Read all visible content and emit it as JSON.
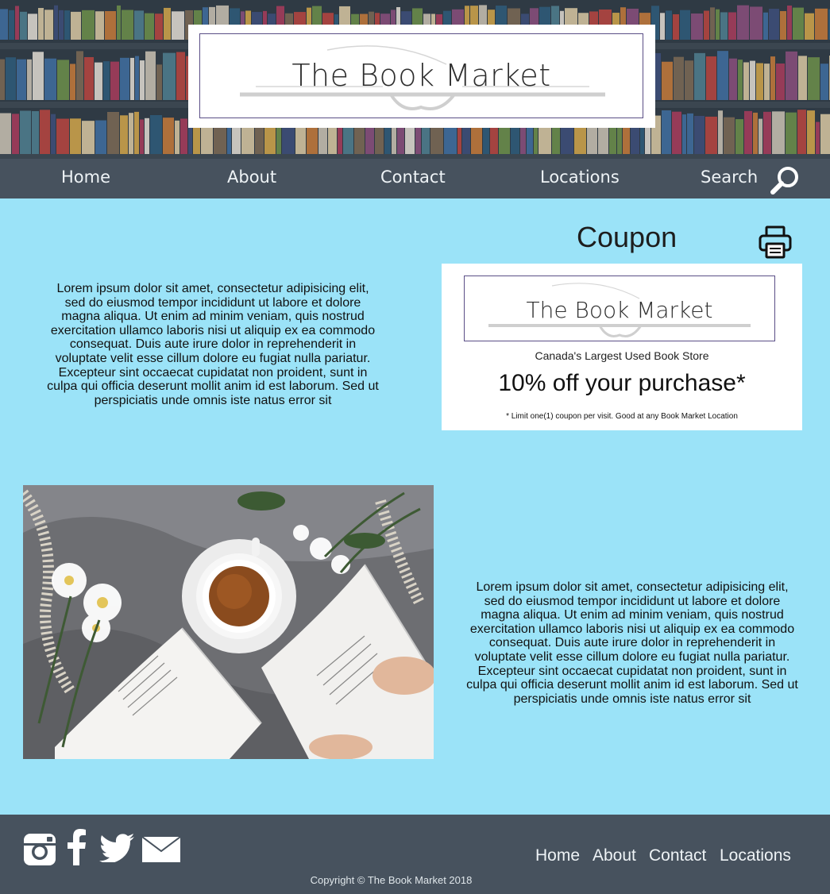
{
  "brand": {
    "name": "The Book Market"
  },
  "nav": {
    "items": [
      "Home",
      "About",
      "Contact",
      "Locations",
      "Search"
    ],
    "search_icon": "search-icon"
  },
  "coupon": {
    "title": "Coupon",
    "print_icon": "printer-icon",
    "logo_text": "The Book Market",
    "tagline": "Canada's Largest Used Book Store",
    "offer": "10% off your purchase*",
    "fine_print": "* Limit one(1) coupon per visit. Good at any Book Market Location"
  },
  "content": {
    "paragraph_1": "Lorem ipsum dolor sit amet, consectetur adipisicing elit, sed do eiusmod tempor incididunt ut labore et dolore magna aliqua. Ut enim ad minim veniam, quis nostrud exercitation ullamco laboris nisi ut aliquip ex ea commodo consequat. Duis aute irure dolor in reprehenderit in voluptate velit esse cillum dolore eu fugiat nulla pariatur. Excepteur sint occaecat cupidatat non proident, sunt in culpa qui officia deserunt mollit anim id est laborum. Sed ut perspiciatis unde omnis iste natus error sit",
    "paragraph_2": "Lorem ipsum dolor sit amet, consectetur adipisicing elit, sed do eiusmod tempor incididunt ut labore et dolore magna aliqua. Ut enim ad minim veniam, quis nostrud exercitation ullamco laboris nisi ut aliquip ex ea commodo consequat. Duis aute irure dolor in reprehenderit in voluptate velit esse cillum dolore eu fugiat nulla pariatur. Excepteur sint occaecat cupidatat non proident, sunt in culpa qui officia deserunt mollit anim id est laborum. Sed ut perspiciatis unde omnis iste natus error sit"
  },
  "footer": {
    "social_icons": [
      "instagram-icon",
      "facebook-icon",
      "twitter-icon",
      "email-icon"
    ],
    "links": [
      "Home",
      "About",
      "Contact",
      "Locations"
    ],
    "copyright": "Copyright © The Book Market 2018"
  },
  "colors": {
    "page_background": "#9be3f8",
    "nav_background": "#47525e",
    "footer_background": "#47525e",
    "logo_border": "#5a4e86"
  }
}
